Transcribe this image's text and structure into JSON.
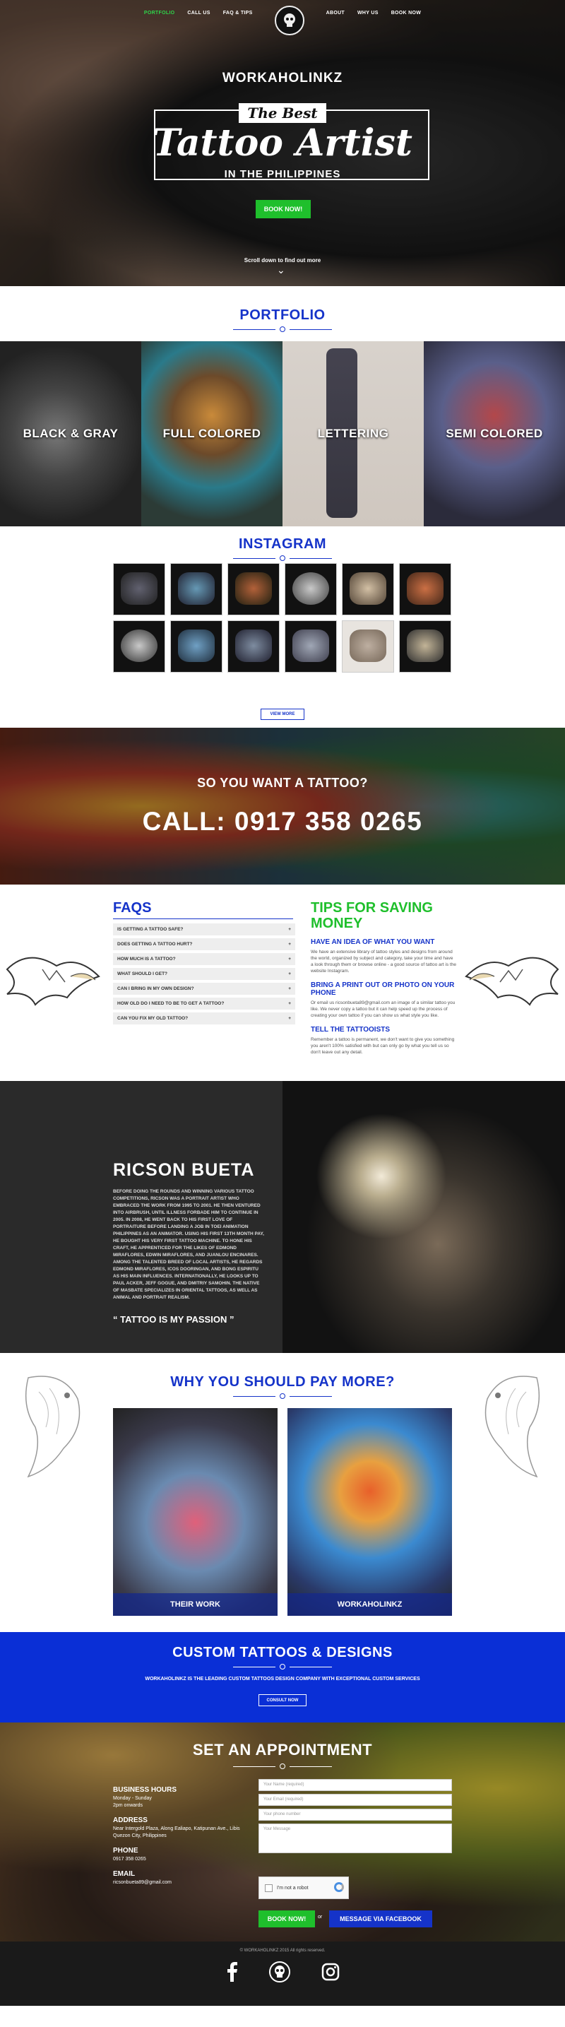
{
  "nav": {
    "items_left": [
      "PORTFOLIO",
      "CALL US",
      "FAQ & TIPS"
    ],
    "items_right": [
      "ABOUT",
      "WHY US",
      "BOOK NOW"
    ],
    "active_color": "#2fd34a"
  },
  "hero": {
    "brand": "WORKAHOLINKZ",
    "best": "The Best",
    "script": "Tattoo Artist",
    "sub": "IN THE PHILIPPINES",
    "cta": "BOOK NOW!",
    "scroll": "Scroll down to find out more"
  },
  "portfolio": {
    "title": "PORTFOLIO",
    "tiles": [
      "BLACK & GRAY",
      "FULL COLORED",
      "LETTERING",
      "SEMI COLORED"
    ]
  },
  "instagram": {
    "title": "INSTAGRAM",
    "view_more": "VIEW MORE"
  },
  "call": {
    "question": "SO YOU WANT A TATTOO?",
    "phone": "CALL: 0917 358 0265"
  },
  "faqs": {
    "title": "FAQS",
    "items": [
      "IS GETTING A TATTOO SAFE?",
      "DOES GETTING A TATTOO HURT?",
      "HOW MUCH IS A TATTOO?",
      "WHAT SHOULD I GET?",
      "CAN I BRING IN MY OWN DESIGN?",
      "HOW OLD DO I NEED TO BE TO GET A TATTOO?",
      "CAN YOU FIX MY OLD TATTOO?"
    ],
    "toggle": "+"
  },
  "tips": {
    "title": "TIPS FOR SAVING MONEY",
    "items": [
      {
        "heading": "HAVE AN IDEA OF WHAT YOU WANT",
        "body": "We have an extensive library of tattoo styles and designs from around the world, organized by subject and category, take your time and have a look through them or browse online - a good source of tattoo art is the website Instagram."
      },
      {
        "heading": "BRING A PRINT OUT OR PHOTO ON YOUR PHONE",
        "body": "Or email us ricsonbueta89@gmail.com an image of a similar tattoo you like. We never copy a tattoo but it can help speed up the process of creating your own tattoo if you can show us what style you like."
      },
      {
        "heading": "TELL THE TATTOOISTS",
        "body": "Remember a tattoo is permanent, we don't want to give you something you aren't 100% satisfied with but can only go by what you tell us so don't leave out any detail."
      }
    ]
  },
  "about": {
    "name": "RICSON BUETA",
    "bio": "Before doing the rounds and winning various tattoo competitions, Ricson was a portrait artist who embraced the work from 1995 to 2001. He then ventured into airbrush, until illness forbade him to continue in 2005. In 2008, he went back to his first love of portraiture before landing a job in Toei Animation Philippines as an animator. Using his first 13th month pay, he bought his very first tattoo machine. To hone his craft, he apprenticed for the likes of Edmond Miraflores, Edwin Miraflores, and Juanlou Encinares. Among the talented breed of local artists, he regards Edmond Miraflores, Icos Dooringan, and Bong Espiritu as his main influences. Internationally, he looks up to Paul Acker, Jeff Gogue, and Dmitriy Samohin. The native of Masbate specializes in oriental tattoos, as well as animal and portrait realism.",
    "quote": "TATTOO IS MY PASSION"
  },
  "why": {
    "title": "WHY YOU SHOULD PAY MORE?",
    "left_label": "THEIR WORK",
    "right_label": "WORKAHOLINKZ"
  },
  "custom": {
    "title": "CUSTOM TATTOOS & DESIGNS",
    "text": "WORKAHOLINKZ IS THE LEADING CUSTOM TATTOOS DESIGN COMPANY WITH EXCEPTIONAL CUSTOM SERVICES",
    "cta": "CONSULT NOW"
  },
  "appointment": {
    "title": "SET AN APPOINTMENT",
    "hours_label": "BUSINESS HOURS",
    "hours": "Monday - Sunday\n2pm onwards",
    "address_label": "ADDRESS",
    "address": "Near Intergold Plaza, Along Ealiapo, Katipunan Ave., Libis Quezon City, Philippines",
    "phone_label": "PHONE",
    "phone": "0917 358 0265",
    "email_label": "EMAIL",
    "email": "ricsonbueta89@gmail.com",
    "fields": {
      "name": "Your Name (required)",
      "email": "Your Email (required)",
      "phone": "Your phone number",
      "message": "Your Message"
    },
    "captcha": "I'm not a robot",
    "book": "BOOK NOW!",
    "or": "or",
    "facebook": "MESSAGE VIA FACEBOOK"
  },
  "footer": {
    "copy": "© WORKAHOLINKZ 2015 All rights reserved."
  }
}
